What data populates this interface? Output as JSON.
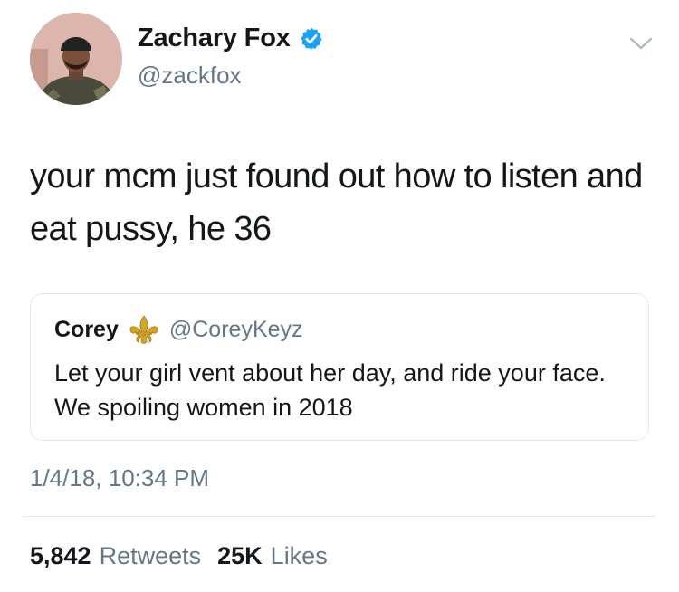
{
  "author": {
    "display_name": "Zachary Fox",
    "handle": "@zackfox",
    "verified_icon": "verified-badge-icon"
  },
  "menu_icon": "chevron-down-icon",
  "tweet": {
    "text": "your mcm just found out how to listen and eat pussy, he 36",
    "timestamp": "1/4/18, 10:34 PM"
  },
  "quoted_tweet": {
    "display_name": "Corey",
    "emoji_icon": "fleur-de-lis-icon",
    "handle": "@CoreyKeyz",
    "text": "Let your girl vent about her day, and ride your face. We spoiling women in 2018"
  },
  "stats": {
    "retweets_count": "5,842",
    "retweets_label": "Retweets",
    "likes_count": "25K",
    "likes_label": "Likes"
  },
  "colors": {
    "text_primary": "#14171a",
    "text_secondary": "#657786",
    "verified_blue": "#1da1f2",
    "border": "#e1e8ed",
    "fleur_gold": "#d4a52b"
  }
}
